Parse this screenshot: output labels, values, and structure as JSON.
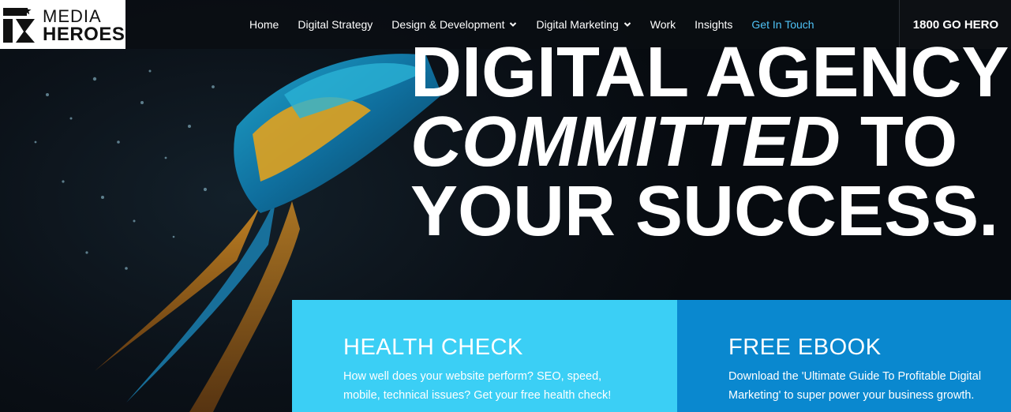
{
  "brand": {
    "line1": "MEDIA",
    "line2": "HEROES"
  },
  "nav": {
    "items": [
      {
        "label": "Home",
        "has_dropdown": false,
        "active": false
      },
      {
        "label": "Digital Strategy",
        "has_dropdown": false,
        "active": false
      },
      {
        "label": "Design & Development",
        "has_dropdown": true,
        "active": false
      },
      {
        "label": "Digital Marketing",
        "has_dropdown": true,
        "active": false
      },
      {
        "label": "Work",
        "has_dropdown": false,
        "active": false
      },
      {
        "label": "Insights",
        "has_dropdown": false,
        "active": false
      },
      {
        "label": "Get In Touch",
        "has_dropdown": false,
        "active": true
      }
    ],
    "phone": "1800 GO HERO"
  },
  "hero": {
    "line1": "DIGITAL AGENCY",
    "line2_italic": "COMMITTED",
    "line2_rest": " TO",
    "line3": "YOUR SUCCESS."
  },
  "cards": {
    "health": {
      "title": "HEALTH CHECK",
      "text": "How well does your website perform? SEO, speed, mobile, technical issues? Get your free health check!"
    },
    "ebook": {
      "title": "FREE EBOOK",
      "text": "Download the 'Ultimate Guide To Profitable Digital Marketing' to super power your business growth."
    }
  },
  "colors": {
    "accent": "#4fc3f7",
    "health_bg": "#3bcff5",
    "ebook_bg": "#0a88cf",
    "nav_bg": "#0a0e12"
  }
}
